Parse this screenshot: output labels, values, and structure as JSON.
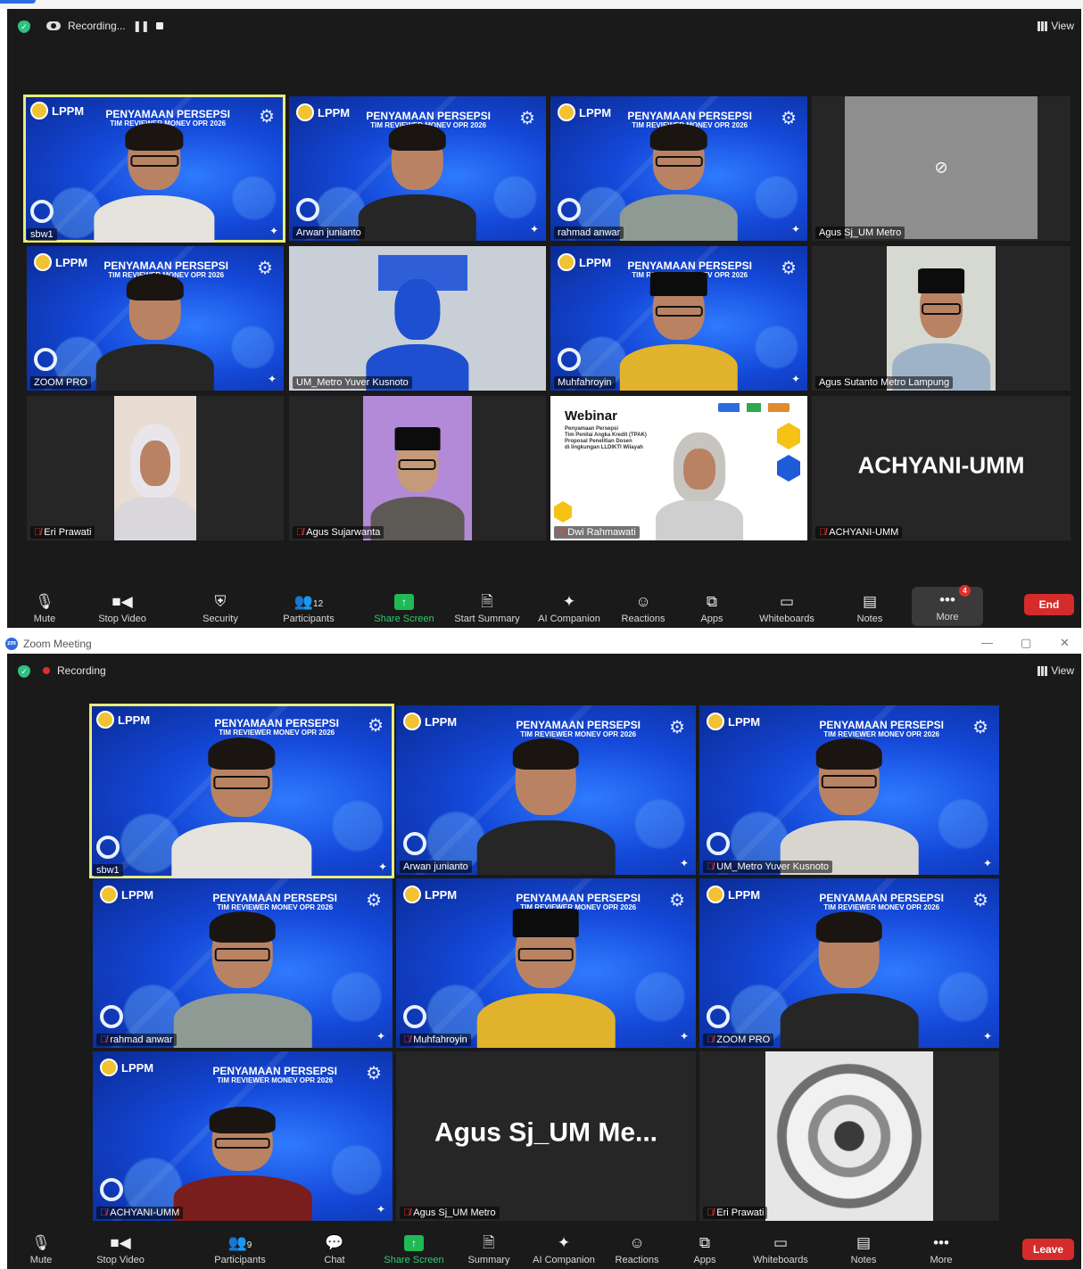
{
  "top_window": {
    "status": {
      "recording_label": "Recording..."
    },
    "view_label": "View",
    "tiles": [
      {
        "name": "sbw1",
        "kind": "blue",
        "muted": false,
        "active": true
      },
      {
        "name": "Arwan junianto",
        "kind": "blue",
        "muted": false
      },
      {
        "name": "rahmad anwar",
        "kind": "blue",
        "muted": false
      },
      {
        "name": "Agus Sj_UM Metro",
        "kind": "camoff",
        "muted": false
      },
      {
        "name": "ZOOM PRO",
        "kind": "blue",
        "muted": false
      },
      {
        "name": "UM_Metro Yuver Kusnoto",
        "kind": "blue",
        "muted": false
      },
      {
        "name": "Muhfahroyin",
        "kind": "blue",
        "muted": false
      },
      {
        "name": "Agus Sutanto Metro Lampung",
        "kind": "photo",
        "muted": false
      },
      {
        "name": "Eri Prawati",
        "kind": "photo",
        "muted": true
      },
      {
        "name": "Agus Sujarwanta",
        "kind": "photo",
        "muted": true
      },
      {
        "name": "Dwi Rahmawati",
        "kind": "webinar",
        "muted": true
      },
      {
        "name": "ACHYANI-UMM",
        "kind": "name",
        "muted": true,
        "big_name": "ACHYANI-UMM"
      }
    ],
    "banner": {
      "title": "PENYAMAAN PERSEPSI",
      "subtitle": "TIM REVIEWER MONEV OPR 2026",
      "org": "LPPM"
    },
    "webinar_slide": {
      "title": "Webinar",
      "lines": [
        "Penyamaan Persepsi",
        "Tim Penilai Angka Kredit (TPAK)",
        "Proposal Penelitian Dosen",
        "di lingkungan LLDIKTI Wilayah"
      ]
    },
    "toolbar": {
      "mute": "Mute",
      "stop_video": "Stop Video",
      "security": "Security",
      "participants": "Participants",
      "participants_count": "12",
      "share_screen": "Share Screen",
      "start_summary": "Start Summary",
      "ai_companion": "AI Companion",
      "reactions": "Reactions",
      "apps": "Apps",
      "whiteboards": "Whiteboards",
      "notes": "Notes",
      "more": "More",
      "more_badge": "4",
      "end": "End"
    }
  },
  "bottom_window": {
    "title": "Zoom Meeting",
    "status": {
      "recording_label": "Recording"
    },
    "view_label": "View",
    "tiles": [
      {
        "name": "sbw1",
        "kind": "blue",
        "muted": false,
        "active": true
      },
      {
        "name": "Arwan junianto",
        "kind": "blue",
        "muted": false
      },
      {
        "name": "UM_Metro Yuver Kusnoto",
        "kind": "blue",
        "muted": true
      },
      {
        "name": "rahmad anwar",
        "kind": "blue",
        "muted": true
      },
      {
        "name": "Muhfahroyin",
        "kind": "blue",
        "muted": true
      },
      {
        "name": "ZOOM PRO",
        "kind": "blue",
        "muted": true
      },
      {
        "name": "ACHYANI-UMM",
        "kind": "blue",
        "muted": true
      },
      {
        "name": "Agus Sj_UM Metro",
        "kind": "name",
        "muted": true,
        "big_name": "Agus Sj_UM Me..."
      },
      {
        "name": "Eri Prawati",
        "kind": "photo",
        "muted": true
      }
    ],
    "toolbar": {
      "mute": "Mute",
      "stop_video": "Stop Video",
      "participants": "Participants",
      "participants_count": "9",
      "chat": "Chat",
      "share_screen": "Share Screen",
      "summary": "Summary",
      "ai_companion": "AI Companion",
      "reactions": "Reactions",
      "apps": "Apps",
      "whiteboards": "Whiteboards",
      "notes": "Notes",
      "more": "More",
      "leave": "Leave"
    }
  },
  "colors": {
    "active_speaker": "#e8ec7a",
    "end": "#d62b2b",
    "share": "#1fb955",
    "background": "#1a1a1a"
  }
}
